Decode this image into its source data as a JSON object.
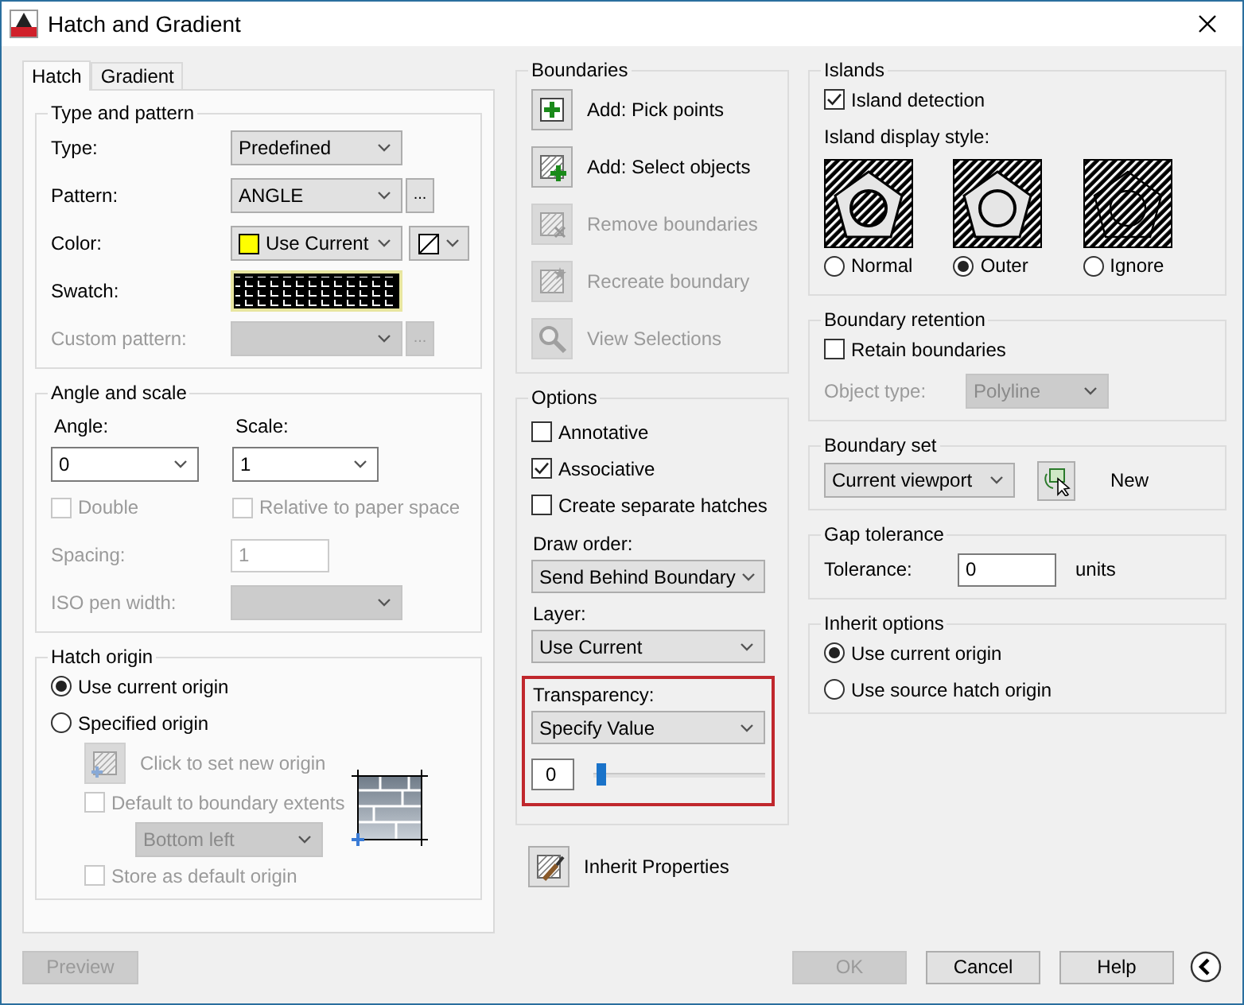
{
  "window": {
    "title": "Hatch and Gradient"
  },
  "tabs": [
    {
      "label": "Hatch",
      "selected": true
    },
    {
      "label": "Gradient",
      "selected": false
    }
  ],
  "left_groups": [
    {
      "title": "Type and pattern",
      "rows": [
        {
          "kind": "select",
          "label": "Type:",
          "value": "Predefined",
          "disabled": false
        },
        {
          "kind": "select",
          "label": "Pattern:",
          "value": "ANGLE",
          "disabled": false,
          "browse": "..."
        },
        {
          "kind": "color",
          "label": "Color:",
          "value": "Use Current",
          "color": "#ffff00"
        },
        {
          "kind": "swatch",
          "label": "Swatch:"
        },
        {
          "kind": "select",
          "label": "Custom pattern:",
          "disabled": true,
          "browse": "..."
        }
      ]
    },
    {
      "title": "Angle and scale",
      "rows": [
        {
          "kind": "pair",
          "items": [
            {
              "label": "Angle:",
              "value": "0"
            },
            {
              "label": "Scale:",
              "value": "1"
            }
          ]
        },
        {
          "kind": "checks",
          "items": [
            {
              "label": "Double",
              "checked": false,
              "disabled": true
            },
            {
              "label": "Relative to paper space",
              "checked": false,
              "disabled": true
            }
          ]
        },
        {
          "kind": "input",
          "label": "Spacing:",
          "value": "1",
          "disabled": true
        },
        {
          "kind": "select",
          "label": "ISO pen width:",
          "disabled": true
        }
      ]
    },
    {
      "title": "Hatch origin",
      "rows": [
        {
          "kind": "radio",
          "label": "Use current origin",
          "selected": true
        },
        {
          "kind": "radio",
          "label": "Specified origin",
          "selected": false
        },
        {
          "kind": "origin",
          "preview": true,
          "rows": [
            {
              "kind": "action",
              "label": "Click to set new origin",
              "disabled": true
            },
            {
              "kind": "check",
              "label": "Default to boundary extents",
              "checked": false,
              "disabled": true
            },
            {
              "kind": "dropdown",
              "value": "Bottom left",
              "disabled": true
            },
            {
              "kind": "check",
              "label": "Store as default origin",
              "checked": false,
              "disabled": true
            }
          ]
        }
      ]
    }
  ],
  "middle_groups": [
    {
      "title": "Boundaries",
      "rows": [
        {
          "kind": "action",
          "label": "Add: Pick points",
          "disabled": false
        },
        {
          "kind": "action",
          "label": "Add: Select objects",
          "disabled": false
        },
        {
          "kind": "action",
          "label": "Remove boundaries",
          "disabled": true
        },
        {
          "kind": "action",
          "label": "Recreate boundary",
          "disabled": true
        },
        {
          "kind": "action",
          "label": "View Selections",
          "disabled": true
        }
      ]
    },
    {
      "title": "Options",
      "rows": [
        {
          "kind": "check",
          "label": "Annotative",
          "checked": false
        },
        {
          "kind": "check",
          "label": "Associative",
          "checked": true
        },
        {
          "kind": "check",
          "label": "Create separate hatches",
          "checked": false
        },
        {
          "kind": "stack",
          "label": "Draw order:",
          "value": "Send Behind Boundary"
        },
        {
          "kind": "stack",
          "label": "Layer:",
          "value": "Use Current"
        },
        {
          "kind": "transparency",
          "label": "Transparency:",
          "value": "Specify Value",
          "field": "0",
          "level": 0.02,
          "highlighted": true
        }
      ]
    }
  ],
  "inherit_button": {
    "kind": "action",
    "label": "Inherit Properties",
    "disabled": false
  },
  "right_groups": [
    {
      "title": "Islands",
      "rows": [
        {
          "kind": "check",
          "label": "Island detection",
          "checked": true
        },
        {
          "kind": "text",
          "label": "Island display style:"
        },
        {
          "kind": "styles",
          "items": [
            {
              "label": "Normal",
              "selected": false
            },
            {
              "label": "Outer",
              "selected": true
            },
            {
              "label": "Ignore",
              "selected": false
            }
          ]
        }
      ]
    },
    {
      "title": "Boundary retention",
      "rows": [
        {
          "kind": "check",
          "label": "Retain boundaries",
          "checked": false
        },
        {
          "kind": "select",
          "label": "Object type:",
          "value": "Polyline",
          "disabled": true
        }
      ]
    },
    {
      "title": "Boundary set",
      "rows": [
        {
          "kind": "boundary-set",
          "value": "Current viewport",
          "button_label": "New"
        }
      ]
    },
    {
      "title": "Gap tolerance",
      "rows": [
        {
          "kind": "input",
          "label": "Tolerance:",
          "value": "0",
          "disabled": false,
          "unit": "units"
        }
      ]
    },
    {
      "title": "Inherit options",
      "rows": [
        {
          "kind": "radio",
          "label": "Use current origin",
          "selected": true
        },
        {
          "kind": "radio",
          "label": "Use source hatch origin",
          "selected": false
        }
      ]
    }
  ],
  "preview_button": {
    "label": "Preview",
    "disabled": true
  },
  "footer_buttons": [
    {
      "label": "OK",
      "disabled": true
    },
    {
      "label": "Cancel",
      "disabled": false
    },
    {
      "label": "Help",
      "disabled": false
    }
  ]
}
